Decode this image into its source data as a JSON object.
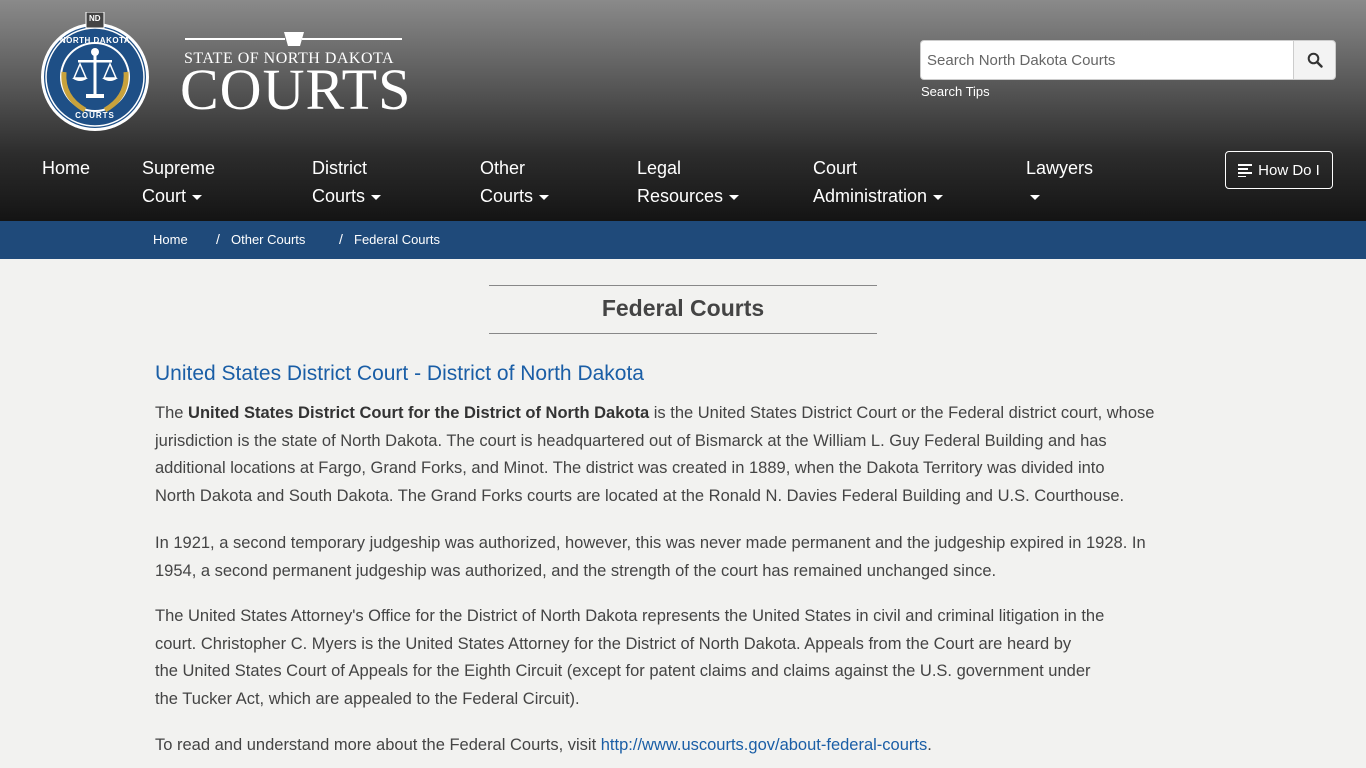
{
  "header": {
    "seal": {
      "badge": "ND",
      "ring_top": "NORTH DAKOTA",
      "ring_bottom": "COURTS"
    },
    "wordmark_top": "STATE OF NORTH DAKOTA",
    "wordmark_main": "COURTS",
    "search": {
      "placeholder": "Search North Dakota Courts",
      "button_icon": "search-icon",
      "tips_label": "Search Tips"
    }
  },
  "nav": {
    "items": [
      {
        "line1": "Home",
        "line2": ""
      },
      {
        "line1": "Supreme",
        "line2": "Court"
      },
      {
        "line1": "District",
        "line2": "Courts"
      },
      {
        "line1": "Other",
        "line2": "Courts"
      },
      {
        "line1": "Legal",
        "line2": "Resources"
      },
      {
        "line1": "Court",
        "line2": "Administration"
      },
      {
        "line1": "Lawyers",
        "line2": ""
      }
    ],
    "how_do_i": "How Do I",
    "how_do_i_icon": "list-icon"
  },
  "breadcrumb": {
    "items": [
      "Home",
      "Other Courts",
      "Federal Courts"
    ],
    "separator": "/"
  },
  "main": {
    "title": "Federal Courts",
    "section_heading": "United States District Court - District of North Dakota",
    "p1": {
      "lead": "The ",
      "bold": "United States District Court for the District of North Dakota",
      "rest_l1": " is the United States District Court or the Federal district court, whose",
      "l2": "jurisdiction is the state of North Dakota. The court is headquartered out of Bismarck at the William L. Guy Federal Building and has",
      "l3": "additional locations at Fargo, Grand Forks, and Minot. The district was created in 1889, when the Dakota Territory was divided into",
      "l4": "North Dakota and South Dakota. The Grand Forks courts are located at the Ronald N. Davies Federal Building and U.S. Courthouse."
    },
    "p2": {
      "l1": "In 1921, a second temporary judgeship was authorized, however, this was never made permanent and the judgeship expired in 1928. In",
      "l2": "1954, a second permanent judgeship was authorized, and the strength of the court has remained unchanged since."
    },
    "p3": {
      "l1": "The United States Attorney's Office for the District of North Dakota represents the United States in civil and criminal litigation in the",
      "l2": "court. Christopher C. Myers is the United States Attorney for the District of North Dakota. Appeals from the Court are heard by",
      "l3": "the United States Court of Appeals for the Eighth Circuit (except for patent claims and claims against the U.S. government under",
      "l4": "the Tucker Act, which are appealed to the Federal Circuit)."
    },
    "p4": {
      "lead": "To read and understand more about the Federal Courts, visit ",
      "link": "http://www.uscourts.gov/about-federal-courts",
      "tail": "."
    }
  },
  "colors": {
    "breadcrumb_bg": "#1f4a7a",
    "link": "#1a5ea6",
    "seal_blue": "#1e4f86",
    "seal_gold": "#c8a23c"
  }
}
